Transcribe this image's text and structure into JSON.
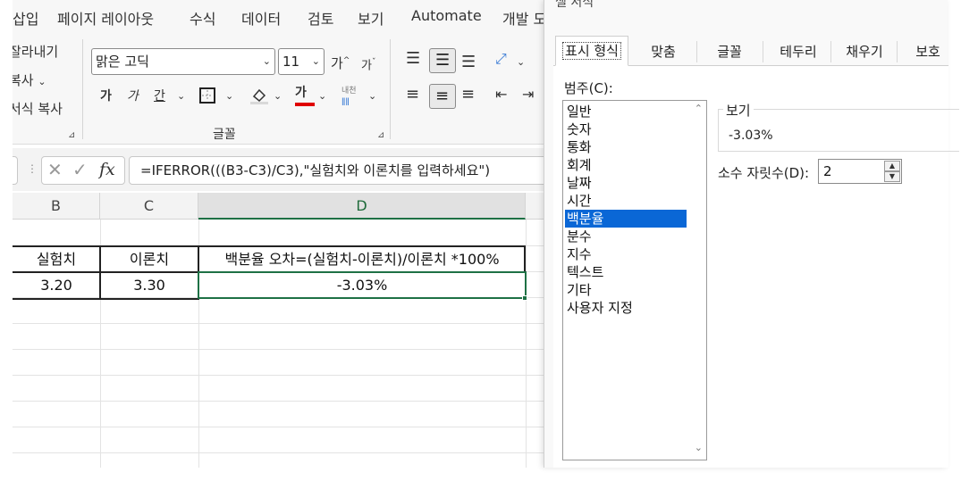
{
  "ribbon": {
    "menu": [
      "삽입",
      "페이지 레이아웃",
      "수식",
      "데이터",
      "검토",
      "보기",
      "Automate",
      "개발 도"
    ],
    "clipboard": {
      "cut": "잘라내기",
      "copy": "복사",
      "format_painter": "서식 복사"
    },
    "font": {
      "name": "맑은 고딕",
      "size": "11",
      "grow": "가",
      "shrink": "가",
      "bold": "가",
      "italic": "가",
      "underline": "간",
      "font_color": "가",
      "phonetic": "내천",
      "group_label": "글꼴"
    },
    "accent_color": "#e00000"
  },
  "formula_bar": {
    "fx": "fx",
    "formula": "=IFERROR(((B3-C3)/C3),\"실험치와 이론치를 입력하세요\")"
  },
  "sheet": {
    "columns": [
      "B",
      "C",
      "D"
    ],
    "header_row": [
      "실험치",
      "이론치",
      "백분율 오차=(실험치-이론치)/이론치 *100%"
    ],
    "data_row": [
      "3.20",
      "3.30",
      "-3.03%"
    ],
    "selected_color": "#1e7145"
  },
  "dialog": {
    "title": "셀 서식",
    "tabs": [
      "표시 형식",
      "맞춤",
      "글꼴",
      "테두리",
      "채우기",
      "보호"
    ],
    "active_tab": "표시 형식",
    "category_label": "범주(C):",
    "categories": [
      "일반",
      "숫자",
      "통화",
      "회계",
      "날짜",
      "시간",
      "백분율",
      "분수",
      "지수",
      "텍스트",
      "기타",
      "사용자 지정"
    ],
    "selected_category": "백분율",
    "sample_label": "보기",
    "sample_value": "-3.03%",
    "decimal_label": "소수 자릿수(D):",
    "decimal_value": "2",
    "selection_color": "#0a67d6"
  }
}
